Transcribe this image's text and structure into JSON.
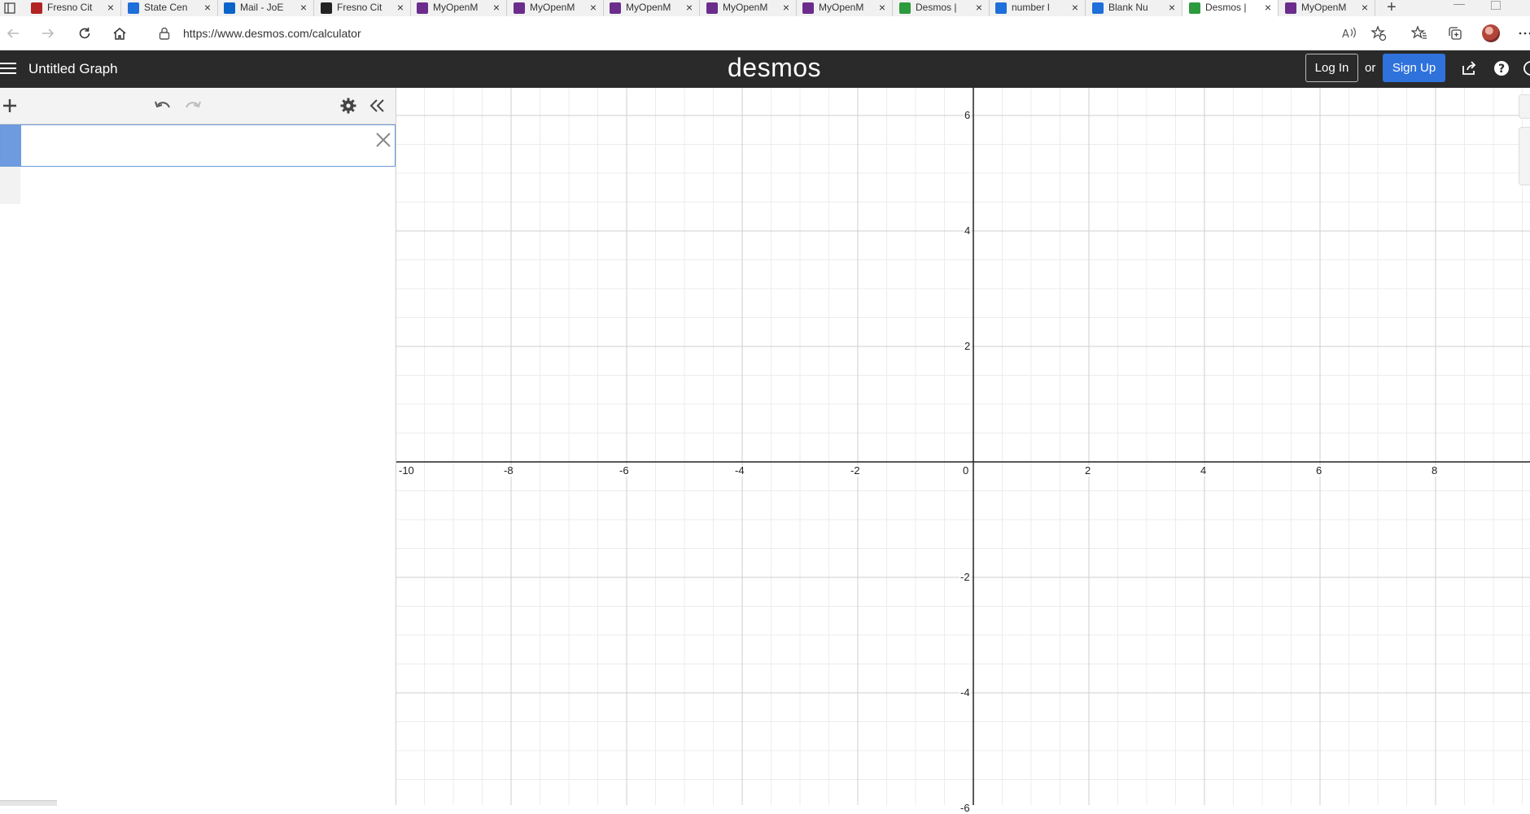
{
  "tabs": [
    {
      "title": "Fresno Cit",
      "favicon": "fresno-city-college-icon",
      "color": "#b22222",
      "active": false
    },
    {
      "title": "State Cen",
      "favicon": "building-icon",
      "color": "#1e6fd9",
      "active": false
    },
    {
      "title": "Mail - JoE",
      "favicon": "outlook-icon",
      "color": "#0a64c9",
      "active": false
    },
    {
      "title": "Fresno Cit",
      "favicon": "sd-icon",
      "color": "#222222",
      "active": false
    },
    {
      "title": "MyOpenM",
      "favicon": "myopenmath-icon",
      "color": "#6b2d8c",
      "active": false
    },
    {
      "title": "MyOpenM",
      "favicon": "myopenmath-icon",
      "color": "#6b2d8c",
      "active": false
    },
    {
      "title": "MyOpenM",
      "favicon": "myopenmath-icon",
      "color": "#6b2d8c",
      "active": false
    },
    {
      "title": "MyOpenM",
      "favicon": "myopenmath-icon",
      "color": "#6b2d8c",
      "active": false
    },
    {
      "title": "MyOpenM",
      "favicon": "myopenmath-icon",
      "color": "#6b2d8c",
      "active": false
    },
    {
      "title": "Desmos |",
      "favicon": "desmos-icon",
      "color": "#2c9b3e",
      "active": false
    },
    {
      "title": "number l",
      "favicon": "search-icon",
      "color": "#1e6fd9",
      "active": false
    },
    {
      "title": "Blank Nu",
      "favicon": "bing-icon",
      "color": "#1e6fd9",
      "active": false
    },
    {
      "title": "Desmos |",
      "favicon": "desmos-icon",
      "color": "#2c9b3e",
      "active": true
    },
    {
      "title": "MyOpenM",
      "favicon": "myopenmath-icon",
      "color": "#6b2d8c",
      "active": false
    }
  ],
  "address_bar": {
    "url": "https://www.desmos.com/calculator"
  },
  "header": {
    "graph_title": "Untitled Graph",
    "logo": "desmos",
    "login_label": "Log In",
    "or_label": "or",
    "signup_label": "Sign Up"
  },
  "expression": {
    "value": "",
    "placeholder": ""
  },
  "graph": {
    "x_range": [
      -10,
      10
    ],
    "y_range": [
      -8,
      6
    ],
    "x_tick_labels": [
      "-10",
      "-8",
      "-6",
      "-4",
      "-2",
      "0",
      "2",
      "4",
      "6",
      "8"
    ],
    "y_tick_labels": [
      "6",
      "4",
      "2",
      "-2",
      "-4",
      "-6"
    ],
    "major_step": 2,
    "minor_step": 0.5,
    "grid": true
  },
  "colors": {
    "header_bg": "#2a2a2a",
    "signup_bg": "#2f72dc",
    "expression_tab": "#6e9be0"
  }
}
